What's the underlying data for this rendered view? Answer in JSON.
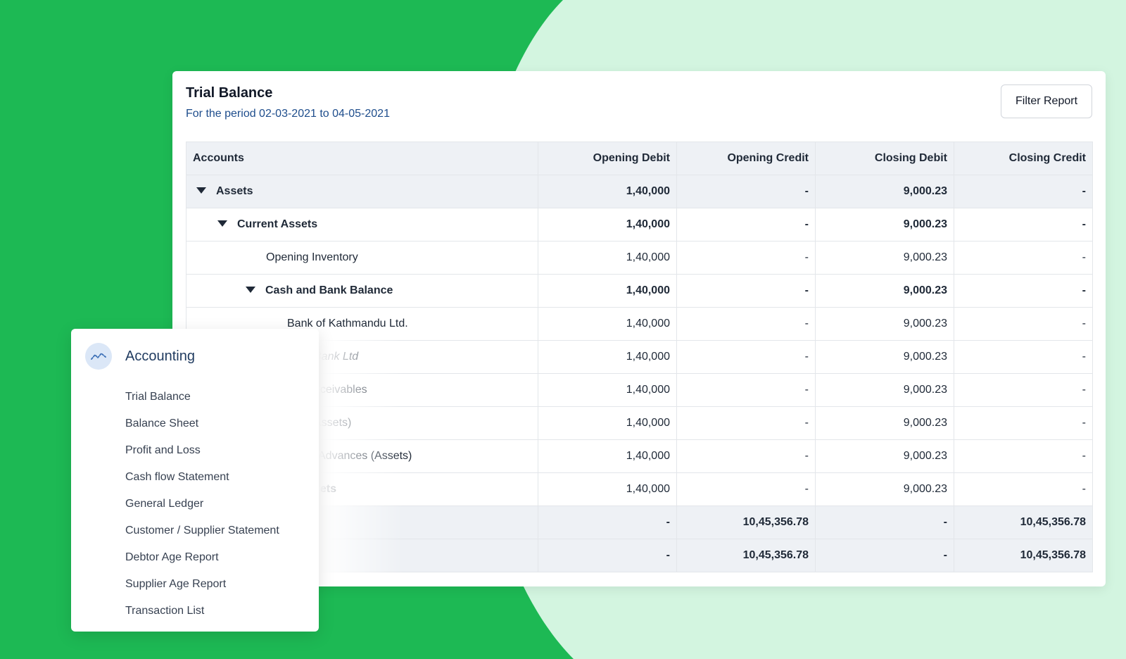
{
  "report": {
    "title": "Trial Balance",
    "subtitle": "For the period 02-03-2021 to 04-05-2021",
    "filter_label": "Filter Report",
    "columns": [
      "Accounts",
      "Opening Debit",
      "Opening Credit",
      "Closing Debit",
      "Closing Credit"
    ],
    "rows": [
      {
        "label": "Assets",
        "opening_debit": "1,40,000",
        "opening_credit": "-",
        "closing_debit": "9,000.23",
        "closing_credit": "-"
      },
      {
        "label": "Current Assets",
        "opening_debit": "1,40,000",
        "opening_credit": "-",
        "closing_debit": "9,000.23",
        "closing_credit": "-"
      },
      {
        "label": "Opening Inventory",
        "opening_debit": "1,40,000",
        "opening_credit": "-",
        "closing_debit": "9,000.23",
        "closing_credit": "-"
      },
      {
        "label": "Cash and Bank Balance",
        "opening_debit": "1,40,000",
        "opening_credit": "-",
        "closing_debit": "9,000.23",
        "closing_credit": "-"
      },
      {
        "label": "Bank of Kathmandu Ltd.",
        "opening_debit": "1,40,000",
        "opening_credit": "-",
        "closing_debit": "9,000.23",
        "closing_credit": "-"
      },
      {
        "label": "Bank Ltd",
        "opening_debit": "1,40,000",
        "opening_credit": "-",
        "closing_debit": "9,000.23",
        "closing_credit": "-"
      },
      {
        "label": "eceivables",
        "opening_debit": "1,40,000",
        "opening_credit": "-",
        "closing_debit": "9,000.23",
        "closing_credit": "-"
      },
      {
        "label": "Assets)",
        "opening_debit": "1,40,000",
        "opening_credit": "-",
        "closing_debit": "9,000.23",
        "closing_credit": "-"
      },
      {
        "label": "Advances (Assets)",
        "opening_debit": "1,40,000",
        "opening_credit": "-",
        "closing_debit": "9,000.23",
        "closing_credit": "-"
      },
      {
        "label": "sets",
        "opening_debit": "1,40,000",
        "opening_credit": "-",
        "closing_debit": "9,000.23",
        "closing_credit": "-"
      }
    ],
    "totals": [
      {
        "opening_debit": "-",
        "opening_credit": "10,45,356.78",
        "closing_debit": "-",
        "closing_credit": "10,45,356.78"
      },
      {
        "opening_debit": "-",
        "opening_credit": "10,45,356.78",
        "closing_debit": "-",
        "closing_credit": "10,45,356.78"
      }
    ]
  },
  "accounting_menu": {
    "title": "Accounting",
    "icon": "trend-line-icon",
    "items": [
      "Trial Balance",
      "Balance Sheet",
      "Profit and Loss",
      "Cash flow Statement",
      "General Ledger",
      "Customer / Supplier Statement",
      "Debtor Age Report",
      "Supplier Age Report",
      "Transaction List"
    ]
  },
  "colors": {
    "background_green": "#1db954",
    "light_green": "#d3f5e0",
    "subtitle_blue": "#1e4d8c",
    "header_gray": "#eef1f5"
  }
}
